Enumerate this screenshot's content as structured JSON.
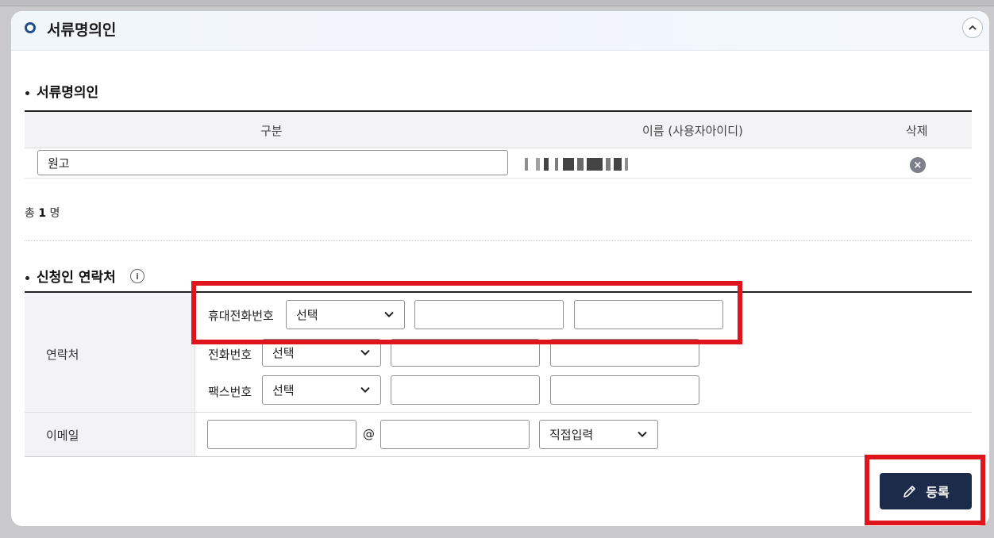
{
  "header": {
    "title": "서류명의인",
    "collapse_icon": "chevron-up-icon"
  },
  "owner_section": {
    "title": "서류명의인",
    "columns": [
      "구분",
      "이름 (사용자아이디)",
      "삭제"
    ],
    "rows": [
      {
        "category": "원고",
        "name": "",
        "delete_icon": "close-circle-icon"
      }
    ],
    "total_prefix": "총",
    "total_count": "1",
    "total_suffix": "명"
  },
  "contact_section": {
    "title": "신청인 연락처",
    "info_icon": "info-icon",
    "contact_label": "연락처",
    "mobile": {
      "label": "휴대전화번호",
      "select": "선택",
      "part2": "",
      "part3": ""
    },
    "phone": {
      "label": "전화번호",
      "select": "선택",
      "part2": "",
      "part3": ""
    },
    "fax": {
      "label": "팩스번호",
      "select": "선택",
      "part2": "",
      "part3": ""
    },
    "email": {
      "label": "이메일",
      "local": "",
      "at": "@",
      "domain": "",
      "domain_select": "직접입력"
    }
  },
  "actions": {
    "register_label": "등록",
    "register_icon": "pencil-icon"
  },
  "colors": {
    "accent": "#1e4f8c",
    "button": "#1c2b4a",
    "highlight": "#e0141c"
  }
}
